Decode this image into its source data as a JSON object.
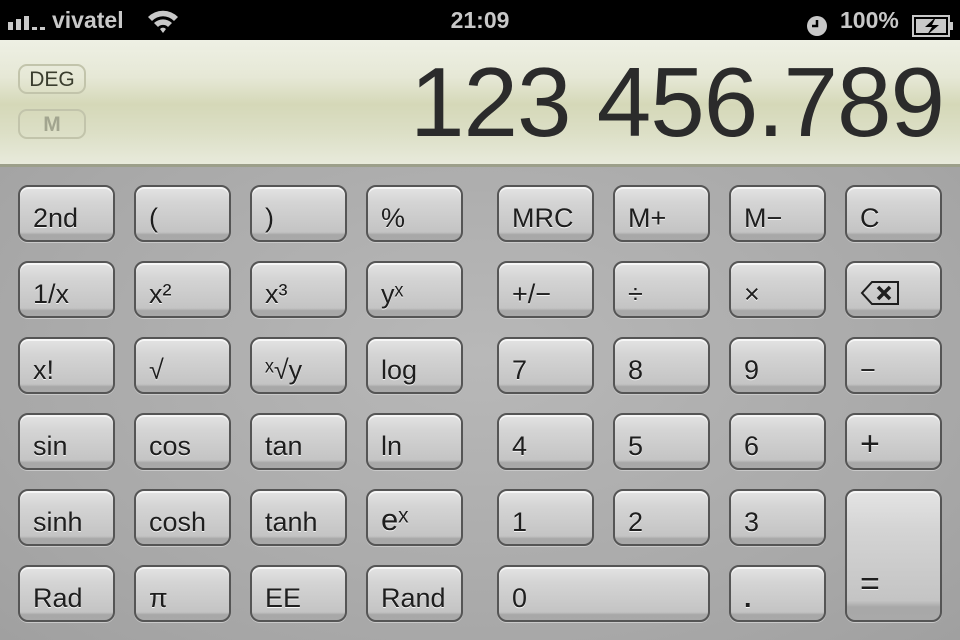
{
  "status_bar": {
    "carrier": "vivatel",
    "signal_bars": 3,
    "wifi_icon": "wifi-icon",
    "time": "21:09",
    "alarm_icon": "alarm-clock-icon",
    "battery_percent": "100%",
    "battery_icon": "battery-charging-icon"
  },
  "display": {
    "angle_mode": "DEG",
    "memory_indicator": "M",
    "value": "123 456.789",
    "colors": {
      "background": "#e0e3cc",
      "text": "#2b2b2b"
    }
  },
  "keypad": {
    "scientific": [
      [
        "2nd",
        "(",
        ")",
        "%"
      ],
      [
        "1/x",
        "x²",
        "x³",
        "yˣ"
      ],
      [
        "x!",
        "√",
        "ˣ√y",
        "log"
      ],
      [
        "sin",
        "cos",
        "tan",
        "ln"
      ],
      [
        "sinh",
        "cosh",
        "tanh",
        "eˣ"
      ],
      [
        "Rad",
        "π",
        "EE",
        "Rand"
      ]
    ],
    "memory": [
      "MRC",
      "M+",
      "M−",
      "C"
    ],
    "ops": {
      "sign": "+/−",
      "divide": "÷",
      "multiply": "×",
      "backspace": "backspace-icon",
      "minus": "−",
      "plus": "+",
      "equals": "="
    },
    "digits": {
      "d7": "7",
      "d8": "8",
      "d9": "9",
      "d4": "4",
      "d5": "5",
      "d6": "6",
      "d1": "1",
      "d2": "2",
      "d3": "3",
      "d0": "0",
      "dot": "."
    }
  }
}
